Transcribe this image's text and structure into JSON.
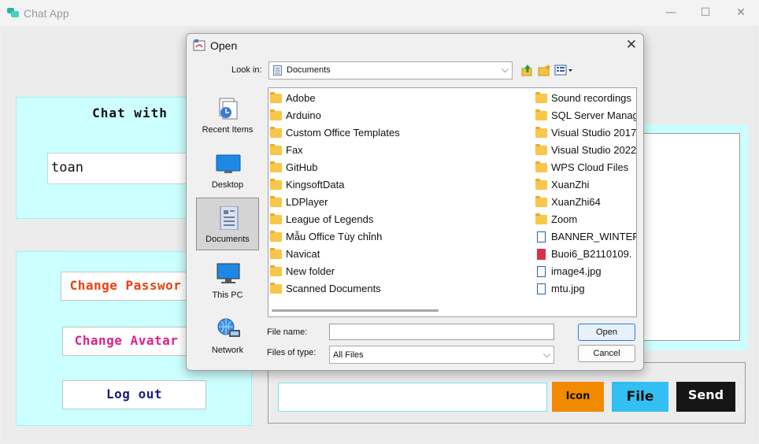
{
  "app": {
    "title": "Chat App",
    "window_controls": {
      "minimize": "—",
      "maximize": "☐",
      "close": "✕"
    }
  },
  "chat_panel": {
    "heading": "Chat with",
    "user_value": "toan"
  },
  "actions": {
    "change_password": {
      "label": "Change Passwor",
      "color": "#e8420e"
    },
    "change_avatar": {
      "label": "Change Avatar",
      "color": "#e0208a"
    },
    "logout": {
      "label": "Log out",
      "color": "#1a1a80"
    }
  },
  "composer": {
    "icon_label": "Icon",
    "file_label": "File",
    "send_label": "Send"
  },
  "dialog": {
    "title": "Open",
    "close_glyph": "✕",
    "look_in_label": "Look in:",
    "look_in_value": "Documents",
    "places": [
      {
        "label": "Recent Items",
        "icon": "recent-items-icon"
      },
      {
        "label": "Desktop",
        "icon": "desktop-icon"
      },
      {
        "label": "Documents",
        "icon": "documents-icon",
        "selected": true
      },
      {
        "label": "This PC",
        "icon": "computer-icon"
      },
      {
        "label": "Network",
        "icon": "network-icon"
      }
    ],
    "files_left": [
      {
        "name": "Adobe",
        "type": "folder"
      },
      {
        "name": "Arduino",
        "type": "folder"
      },
      {
        "name": "Custom Office Templates",
        "type": "folder"
      },
      {
        "name": "Fax",
        "type": "folder"
      },
      {
        "name": "GitHub",
        "type": "folder"
      },
      {
        "name": "KingsoftData",
        "type": "folder"
      },
      {
        "name": "LDPlayer",
        "type": "folder"
      },
      {
        "name": "League of Legends",
        "type": "folder"
      },
      {
        "name": "Mẫu Office Tùy chỉnh",
        "type": "folder"
      },
      {
        "name": "Navicat",
        "type": "folder"
      },
      {
        "name": "New folder",
        "type": "folder"
      },
      {
        "name": "Scanned Documents",
        "type": "folder"
      }
    ],
    "files_right": [
      {
        "name": "Sound recordings",
        "type": "folder"
      },
      {
        "name": "SQL Server Manag",
        "type": "folder"
      },
      {
        "name": "Visual Studio 2017",
        "type": "folder"
      },
      {
        "name": "Visual Studio 2022",
        "type": "folder"
      },
      {
        "name": "WPS Cloud Files",
        "type": "folder"
      },
      {
        "name": "XuanZhi",
        "type": "folder"
      },
      {
        "name": "XuanZhi64",
        "type": "folder"
      },
      {
        "name": "Zoom",
        "type": "folder"
      },
      {
        "name": "BANNER_WINTER_",
        "type": "file"
      },
      {
        "name": "Buoi6_B2110109.",
        "type": "pdf"
      },
      {
        "name": "image4.jpg",
        "type": "file"
      },
      {
        "name": "mtu.jpg",
        "type": "file"
      }
    ],
    "file_name_label": "File name:",
    "file_name_value": "",
    "files_of_type_label": "Files of type:",
    "files_of_type_value": "All Files",
    "open_label": "Open",
    "cancel_label": "Cancel"
  }
}
